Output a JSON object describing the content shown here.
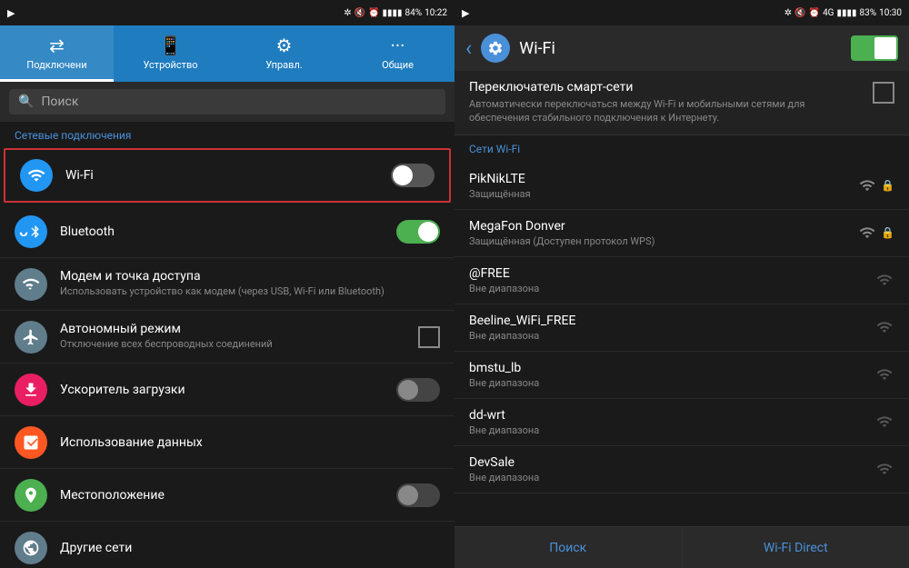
{
  "left": {
    "statusBar": {
      "playIcon": "▶",
      "btIcon": "⊕",
      "muteIcon": "✕",
      "alarmIcon": "⏰",
      "signalBars": "▮▮▮▮",
      "battery": "84%",
      "time": "10:22"
    },
    "tabs": [
      {
        "id": "connections",
        "label": "Подключени",
        "icon": "⇄"
      },
      {
        "id": "device",
        "label": "Устройство",
        "icon": "📱"
      },
      {
        "id": "controls",
        "label": "Управл.",
        "icon": "⚙"
      },
      {
        "id": "general",
        "label": "Общие",
        "icon": "···"
      }
    ],
    "activeTab": "connections",
    "search": {
      "placeholder": "Поиск"
    },
    "sectionHeader": "Сетевые подключения",
    "items": [
      {
        "id": "wifi",
        "title": "Wi-Fi",
        "subtitle": "",
        "iconType": "wifi",
        "iconSymbol": "📶",
        "toggle": "off",
        "highlighted": true
      },
      {
        "id": "bluetooth",
        "title": "Bluetooth",
        "subtitle": "",
        "iconType": "bt",
        "iconSymbol": "🔵",
        "toggle": "on"
      },
      {
        "id": "modem",
        "title": "Модем и точка доступа",
        "subtitle": "Использовать устройство как модем (через USB, Wi-Fi или Bluetooth)",
        "iconType": "modem",
        "iconSymbol": "📡",
        "toggle": ""
      },
      {
        "id": "airplane",
        "title": "Автономный режим",
        "subtitle": "Отключение всех беспроводных соединений",
        "iconType": "airplane",
        "iconSymbol": "✈",
        "toggle": "checkbox"
      },
      {
        "id": "speed",
        "title": "Ускоритель загрузки",
        "subtitle": "",
        "iconType": "speed",
        "iconSymbol": "⬇",
        "toggle": "off"
      },
      {
        "id": "data",
        "title": "Использование данных",
        "subtitle": "",
        "iconType": "data",
        "iconSymbol": "📊",
        "toggle": ""
      },
      {
        "id": "location",
        "title": "Местоположение",
        "subtitle": "",
        "iconType": "location",
        "iconSymbol": "📍",
        "toggle": "off"
      },
      {
        "id": "other",
        "title": "Другие сети",
        "subtitle": "",
        "iconType": "other",
        "iconSymbol": "🌐",
        "toggle": ""
      }
    ]
  },
  "right": {
    "statusBar": {
      "playIcon": "▶",
      "btIcon": "⊕",
      "muteIcon": "✕",
      "alarmIcon": "⏰",
      "network": "4G",
      "battery": "83%",
      "time": "10:30"
    },
    "header": {
      "back": "‹",
      "gearIcon": "⚙",
      "title": "Wi-Fi",
      "toggleState": "on"
    },
    "smartSwitch": {
      "title": "Переключатель смарт-сети",
      "description": "Автоматически переключаться между Wi-Fi и мобильными сетями для обеспечения стабильного подключения к Интернету."
    },
    "wifiSectionLabel": "Сети Wi-Fi",
    "networks": [
      {
        "name": "PikNikLTE",
        "status": "Защищённая",
        "signalLevel": 4,
        "locked": true
      },
      {
        "name": "MegaFon Donver",
        "status": "Защищённая (Доступен протокол WPS)",
        "signalLevel": 3,
        "locked": true
      },
      {
        "name": "@FREE",
        "status": "Вне диапазона",
        "signalLevel": 2,
        "locked": false
      },
      {
        "name": "Beeline_WiFi_FREE",
        "status": "Вне диапазона",
        "signalLevel": 2,
        "locked": false
      },
      {
        "name": "bmstu_lb",
        "status": "Вне диапазона",
        "signalLevel": 2,
        "locked": false
      },
      {
        "name": "dd-wrt",
        "status": "Вне диапазона",
        "signalLevel": 1,
        "locked": false
      },
      {
        "name": "DevSale",
        "status": "Вне диапазона",
        "signalLevel": 1,
        "locked": false
      }
    ],
    "bottomButtons": [
      {
        "id": "search",
        "label": "Поиск"
      },
      {
        "id": "wifidirect",
        "label": "Wi-Fi Direct"
      }
    ]
  }
}
